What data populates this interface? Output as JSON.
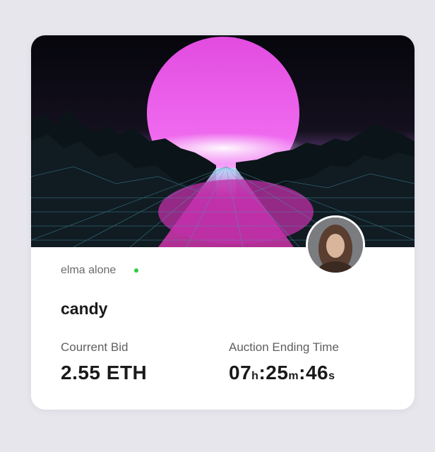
{
  "card": {
    "creator_name": "elma alone",
    "title": "candy",
    "bid_label": "Courrent Bid",
    "bid_value": "2.55 ETH",
    "timer_label": "Auction Ending Time",
    "timer": {
      "hours": "07",
      "hours_unit": "h",
      "sep1": ":",
      "minutes": "25",
      "minutes_unit": "m",
      "sep2": ":",
      "seconds": "46",
      "seconds_unit": "s"
    }
  },
  "colors": {
    "online": "#2ecc40",
    "sun": "#e24ce0",
    "grid": "#d640c8",
    "sky": "#0c0c16"
  },
  "icons": {
    "avatar": "creator-avatar",
    "status": "online-dot"
  }
}
